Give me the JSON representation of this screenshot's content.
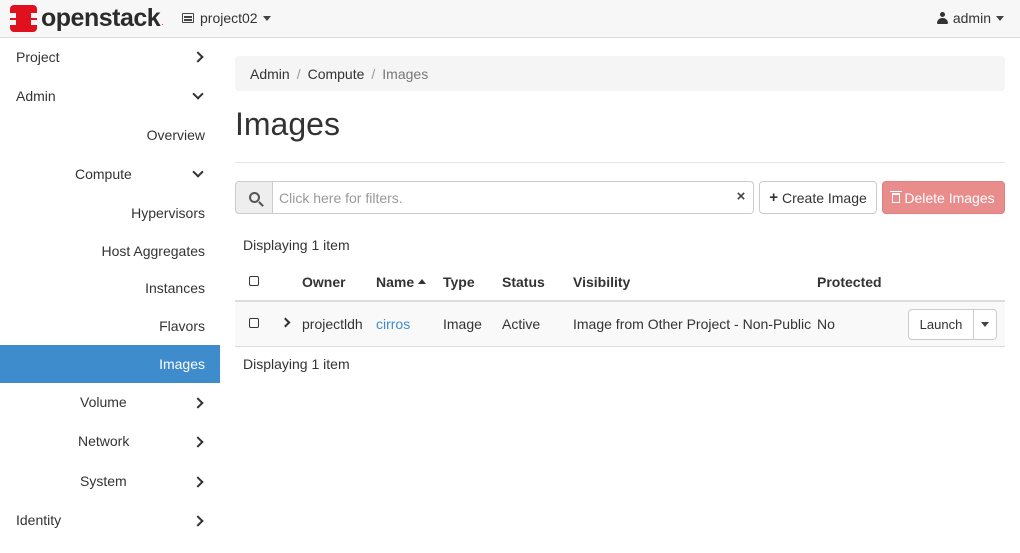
{
  "navbar": {
    "brand": "openstack",
    "brand_mark": ".",
    "project": "project02",
    "user": "admin"
  },
  "sidebar": {
    "items": [
      {
        "label": "Project"
      },
      {
        "label": "Admin"
      },
      {
        "label": "Overview"
      },
      {
        "label": "Compute"
      },
      {
        "label": "Hypervisors"
      },
      {
        "label": "Host Aggregates"
      },
      {
        "label": "Instances"
      },
      {
        "label": "Flavors"
      },
      {
        "label": "Images"
      },
      {
        "label": "Volume"
      },
      {
        "label": "Network"
      },
      {
        "label": "System"
      },
      {
        "label": "Identity"
      }
    ],
    "active_color": "#3f8ccd"
  },
  "breadcrumb": {
    "items": [
      "Admin",
      "Compute",
      "Images"
    ],
    "separator": "/"
  },
  "page": {
    "title": "Images"
  },
  "filter": {
    "placeholder": "Click here for filters.",
    "clear": "×"
  },
  "actions": {
    "create": "Create Image",
    "delete": "Delete Images"
  },
  "table": {
    "count_top": "Displaying 1 item",
    "count_bottom": "Displaying 1 item",
    "columns": [
      "Owner",
      "Name",
      "Type",
      "Status",
      "Visibility",
      "Protected"
    ],
    "rows": [
      {
        "owner": "projectldh",
        "name": "cirros",
        "type": "Image",
        "status": "Active",
        "visibility": "Image from Other Project - Non-Public",
        "protected": "No",
        "action": "Launch"
      }
    ]
  }
}
